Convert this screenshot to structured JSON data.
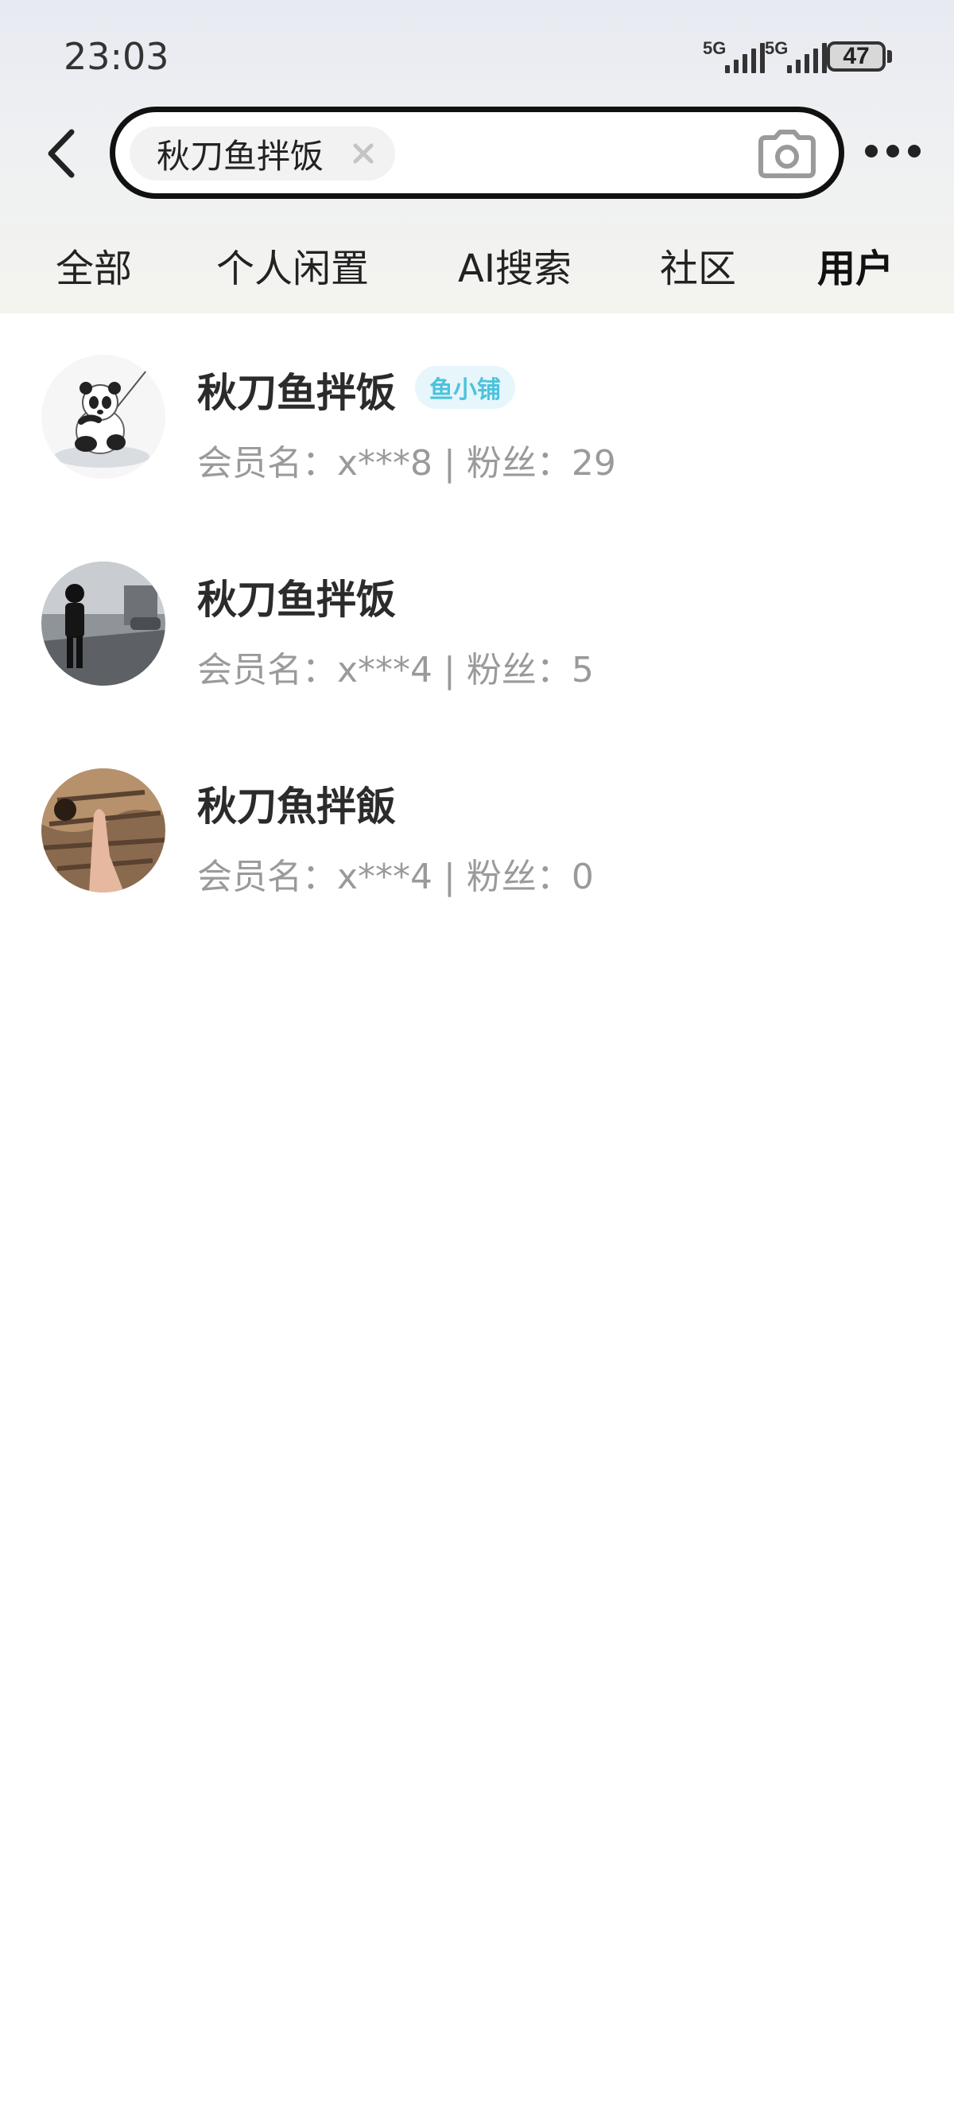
{
  "status_bar": {
    "time": "23:03",
    "signal_1_label": "5G",
    "signal_2_label": "5G",
    "battery_level": "47"
  },
  "search": {
    "query": "秋刀鱼拌饭",
    "back_icon": "chevron-left-icon",
    "clear_icon": "close-icon",
    "camera_icon": "camera-icon",
    "more_icon": "more-dots-icon"
  },
  "tabs": [
    {
      "label": "全部",
      "active": false
    },
    {
      "label": "个人闲置",
      "active": false
    },
    {
      "label": "AI搜索",
      "active": false
    },
    {
      "label": "社区",
      "active": false
    },
    {
      "label": "用户",
      "active": true
    }
  ],
  "colors": {
    "active_tab_highlight": "#ffe24a",
    "badge_text": "#4cc3dc",
    "badge_bg": "#e6f6fb",
    "meta_text": "#9a9a9a"
  },
  "users": [
    {
      "name": "秋刀鱼拌饭",
      "badge": "鱼小铺",
      "meta": "会员名：x***8 | 粉丝：29",
      "avatar": "panda-fishing-avatar"
    },
    {
      "name": "秋刀鱼拌饭",
      "badge": null,
      "meta": "会员名：x***4 | 粉丝：5",
      "avatar": "person-standing-avatar"
    },
    {
      "name": "秋刀魚拌飯",
      "badge": null,
      "meta": "会员名：x***4 | 粉丝：0",
      "avatar": "cat-hand-avatar"
    }
  ]
}
